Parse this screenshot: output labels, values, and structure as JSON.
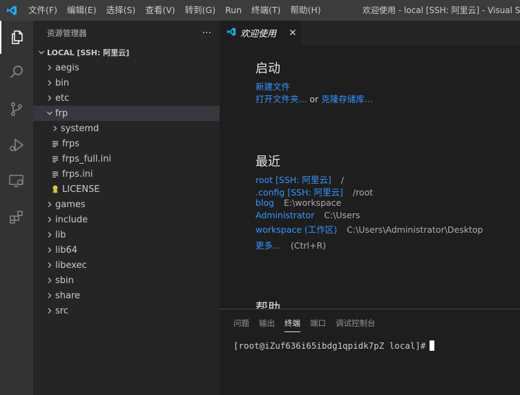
{
  "titlebar": {
    "menu": [
      "文件(F)",
      "编辑(E)",
      "选择(S)",
      "查看(V)",
      "转到(G)",
      "Run",
      "终端(T)",
      "帮助(H)"
    ],
    "window_title": "欢迎使用 - local [SSH: 阿里云] - Visual Studio Code",
    "accent": "#23a9f2"
  },
  "activitybar": {
    "items": [
      "explorer-icon",
      "search-icon",
      "source-control-icon",
      "run-debug-icon",
      "remote-explorer-icon",
      "extensions-icon"
    ]
  },
  "sidebar": {
    "header": "资源管理器",
    "more": "···",
    "section": "LOCAL [SSH: 阿里云]",
    "items": [
      {
        "label": "aegis",
        "type": "folder"
      },
      {
        "label": "bin",
        "type": "folder"
      },
      {
        "label": "etc",
        "type": "folder"
      },
      {
        "label": "frp",
        "type": "folder-open"
      },
      {
        "label": "systemd",
        "type": "folder"
      },
      {
        "label": "frps",
        "type": "file"
      },
      {
        "label": "frps_full.ini",
        "type": "file"
      },
      {
        "label": "frps.ini",
        "type": "file"
      },
      {
        "label": "LICENSE",
        "type": "license"
      },
      {
        "label": "games",
        "type": "folder"
      },
      {
        "label": "include",
        "type": "folder"
      },
      {
        "label": "lib",
        "type": "folder"
      },
      {
        "label": "lib64",
        "type": "folder"
      },
      {
        "label": "libexec",
        "type": "folder"
      },
      {
        "label": "sbin",
        "type": "folder"
      },
      {
        "label": "share",
        "type": "folder"
      },
      {
        "label": "src",
        "type": "folder"
      }
    ]
  },
  "editor": {
    "tab": {
      "label": "欢迎使用",
      "close": "✕"
    }
  },
  "welcome": {
    "start": {
      "heading": "启动",
      "new_file": "新建文件",
      "open_folder": "打开文件夹...",
      "or": "or",
      "clone": "克隆存储库..."
    },
    "recent": {
      "heading": "最近",
      "items": [
        {
          "name": "root [SSH: 阿里云]",
          "path": "/"
        },
        {
          "name": ".config [SSH: 阿里云]",
          "path": "/root"
        },
        {
          "name": "blog",
          "path": "E:\\workspace"
        },
        {
          "name": "Administrator",
          "path": "C:\\Users"
        },
        {
          "name": "workspace (工作区)",
          "path": "C:\\Users\\Administrator\\Desktop"
        }
      ],
      "more": "更多...",
      "more_shortcut": "(Ctrl+R)"
    },
    "help": {
      "heading": "帮助"
    }
  },
  "panel": {
    "tabs": [
      "问题",
      "输出",
      "终端",
      "端口",
      "调试控制台"
    ],
    "active_tab": "终端",
    "terminal_prompt": "[root@iZuf636i65ibdg1qpidk7pZ local]#"
  }
}
